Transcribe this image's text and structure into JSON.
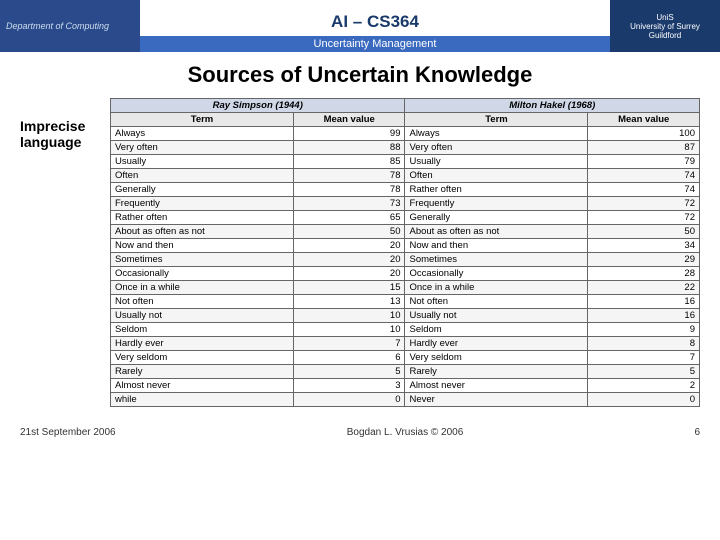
{
  "header": {
    "dept_label": "Department of Computing",
    "title": "AI – CS364",
    "subtitle": "Uncertainty Management",
    "uni_label": "UniS\nUniversity of Surrey\nGuildford"
  },
  "page": {
    "title": "Sources of Uncertain Knowledge",
    "side_label_line1": "Imprecise",
    "side_label_line2": "language"
  },
  "table": {
    "sources": [
      {
        "name": "Ray Simpson",
        "year": "(1944)"
      },
      {
        "name": "Milton Hakel",
        "year": "(1968)"
      }
    ],
    "columns": [
      "Term",
      "Mean value",
      "Term",
      "Mean value"
    ],
    "rows": [
      {
        "term1": "Always",
        "val1": "99",
        "term2": "Always",
        "val2": "100"
      },
      {
        "term1": "Very often",
        "val1": "88",
        "term2": "Very often",
        "val2": "87"
      },
      {
        "term1": "Usually",
        "val1": "85",
        "term2": "Usually",
        "val2": "79"
      },
      {
        "term1": "Often",
        "val1": "78",
        "term2": "Often",
        "val2": "74"
      },
      {
        "term1": "Generally",
        "val1": "78",
        "term2": "Rather often",
        "val2": "74"
      },
      {
        "term1": "Frequently",
        "val1": "73",
        "term2": "Frequently",
        "val2": "72"
      },
      {
        "term1": "Rather often",
        "val1": "65",
        "term2": "Generally",
        "val2": "72"
      },
      {
        "term1": "About as often as not",
        "val1": "50",
        "term2": "About as often as not",
        "val2": "50"
      },
      {
        "term1": "Now and then",
        "val1": "20",
        "term2": "Now and then",
        "val2": "34"
      },
      {
        "term1": "Sometimes",
        "val1": "20",
        "term2": "Sometimes",
        "val2": "29"
      },
      {
        "term1": "Occasionally",
        "val1": "20",
        "term2": "Occasionally",
        "val2": "28"
      },
      {
        "term1": "Once in a while",
        "val1": "15",
        "term2": "Once in a while",
        "val2": "22"
      },
      {
        "term1": "Not often",
        "val1": "13",
        "term2": "Not often",
        "val2": "16"
      },
      {
        "term1": "Usually not",
        "val1": "10",
        "term2": "Usually not",
        "val2": "16"
      },
      {
        "term1": "Seldom",
        "val1": "10",
        "term2": "Seldom",
        "val2": "9"
      },
      {
        "term1": "Hardly ever",
        "val1": "7",
        "term2": "Hardly ever",
        "val2": "8"
      },
      {
        "term1": "Very seldom",
        "val1": "6",
        "term2": "Very seldom",
        "val2": "7"
      },
      {
        "term1": "Rarely",
        "val1": "5",
        "term2": "Rarely",
        "val2": "5"
      },
      {
        "term1": "Almost never",
        "val1": "3",
        "term2": "Almost never",
        "val2": "2"
      },
      {
        "term1": "while",
        "val1": "0",
        "term2": "Never",
        "val2": "0"
      }
    ]
  },
  "footer": {
    "date": "21st September 2006",
    "author": "Bogdan L. Vrusias © 2006",
    "page_num": "6"
  }
}
